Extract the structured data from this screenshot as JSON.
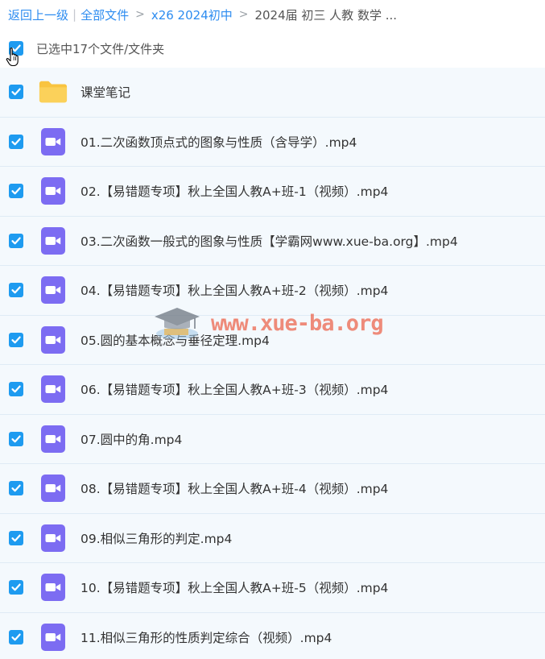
{
  "breadcrumb": {
    "back": "返回上一级",
    "all_files": "全部文件",
    "folder1": "x26 2024初中",
    "current": "2024届 初三 人教 数学 ..."
  },
  "selection": {
    "label": "已选中17个文件/文件夹"
  },
  "files": [
    {
      "name": "课堂笔记",
      "icon": "folder-icon"
    },
    {
      "name": "01.二次函数顶点式的图象与性质（含导学）.mp4",
      "icon": "video-icon"
    },
    {
      "name": "02.【易错题专项】秋上全国人教A+班-1（视频）.mp4",
      "icon": "video-icon"
    },
    {
      "name": "03.二次函数一般式的图象与性质【学霸网www.xue-ba.org】.mp4",
      "icon": "video-icon"
    },
    {
      "name": "04.【易错题专项】秋上全国人教A+班-2（视频）.mp4",
      "icon": "video-icon"
    },
    {
      "name": "05.圆的基本概念与垂径定理.mp4",
      "icon": "video-icon"
    },
    {
      "name": "06.【易错题专项】秋上全国人教A+班-3（视频）.mp4",
      "icon": "video-icon"
    },
    {
      "name": "07.圆中的角.mp4",
      "icon": "video-icon"
    },
    {
      "name": "08.【易错题专项】秋上全国人教A+班-4（视频）.mp4",
      "icon": "video-icon"
    },
    {
      "name": "09.相似三角形的判定.mp4",
      "icon": "video-icon"
    },
    {
      "name": "10.【易错题专项】秋上全国人教A+班-5（视频）.mp4",
      "icon": "video-icon"
    },
    {
      "name": "11.相似三角形的性质判定综合（视频）.mp4",
      "icon": "video-icon"
    }
  ],
  "watermark": {
    "text": "www.xue-ba.org"
  },
  "colors": {
    "link": "#2d8cf0",
    "checkbox": "#1e9bf0",
    "video": "#7c6cf2",
    "folder": "#f9c440",
    "row_bg": "#f4f9fd",
    "watermark": "#eb5f46"
  }
}
